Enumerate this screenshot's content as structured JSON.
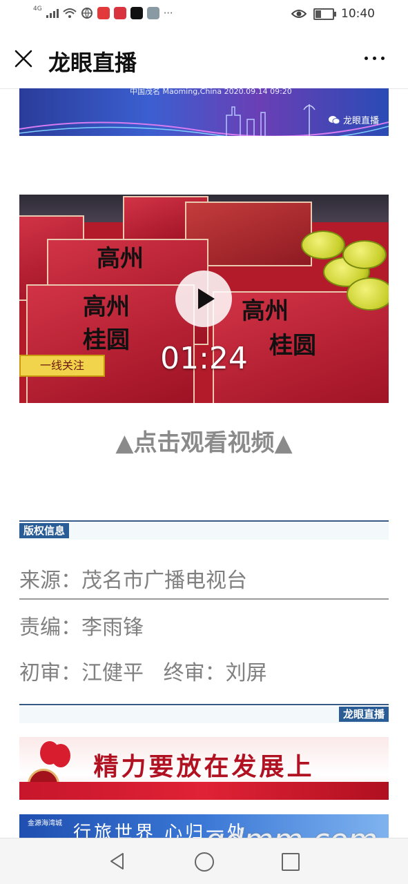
{
  "status_bar": {
    "network": "4G",
    "time": "10:40"
  },
  "header": {
    "title": "龙眼直播"
  },
  "top_banner": {
    "caption": "中国茂名 Maoming,China 2020.09.14 09:20",
    "watermark": "龙眼直播"
  },
  "video": {
    "tag": "一线关注",
    "box_text_1": "高州",
    "box_text_2": "桂圆",
    "duration": "01:24"
  },
  "watch_label": "▲点击观看视频▲",
  "copyright": {
    "section_label": "版权信息",
    "source": "来源：茂名市广播电视台",
    "editor": "责编：李雨锋",
    "review": "初审：江健平   终审：刘屏"
  },
  "brand_label": "龙眼直播",
  "banner2": {
    "slogan": "精力要放在发展上"
  },
  "banner3": {
    "logo_text": "金源海湾城",
    "text": "行旅世界 心归一处"
  },
  "site_watermark": "gdmm.com",
  "colors": {
    "section_blue": "#2a5c95",
    "label_gray": "#8a8a8a"
  }
}
